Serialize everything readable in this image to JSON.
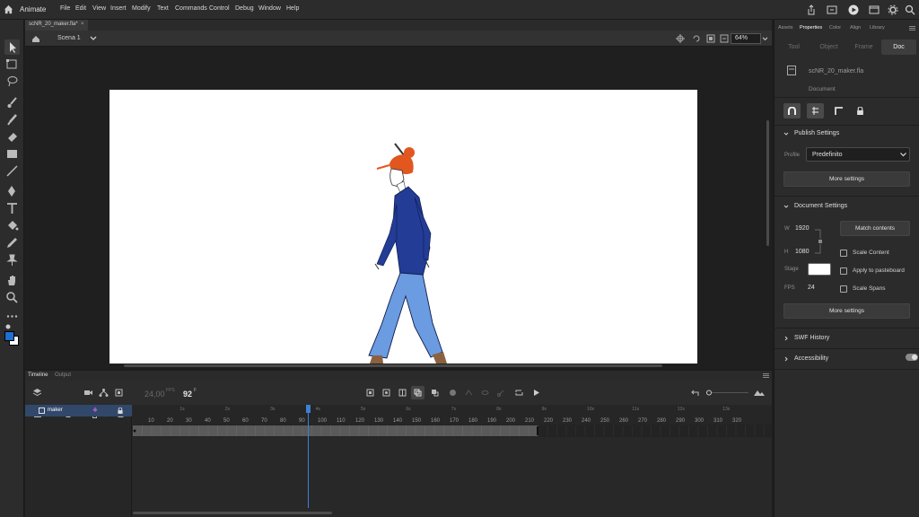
{
  "app": {
    "name": "Animate"
  },
  "menu": [
    "File",
    "Edit",
    "View",
    "Insert",
    "Modify",
    "Text",
    "Commands",
    "Control",
    "Debug",
    "Window",
    "Help"
  ],
  "document": {
    "tab_title": "scNR_20_maker.fla*",
    "tab_close": "×"
  },
  "editbar": {
    "scene": "Scena 1",
    "zoom": "64%"
  },
  "timeline": {
    "tabs": [
      "Timeline",
      "Output"
    ],
    "fps": "24,00",
    "fps_unit": "FPS",
    "current_frame": "92",
    "frame_unit": "F",
    "seconds": [
      "1s",
      "2s",
      "3s",
      "4s",
      "5s",
      "6s",
      "7s",
      "8s",
      "9s",
      "10s",
      "11s",
      "12s",
      "13s"
    ],
    "ticks": [
      "10",
      "20",
      "30",
      "40",
      "50",
      "60",
      "70",
      "80",
      "90",
      "100",
      "110",
      "120",
      "130",
      "140",
      "150",
      "160",
      "170",
      "180",
      "190",
      "200",
      "210",
      "220",
      "230",
      "240",
      "250",
      "260",
      "270",
      "280",
      "290",
      "300",
      "310",
      "320"
    ],
    "layer": {
      "name": "maker"
    }
  },
  "properties": {
    "panel_tabs": [
      "Assets",
      "Properties",
      "Color",
      "Align",
      "Library"
    ],
    "segments": [
      "Tool",
      "Object",
      "Frame",
      "Doc"
    ],
    "file_name": "scNR_20_maker.fla",
    "doc_label": "Document",
    "publish": {
      "title": "Publish Settings",
      "profile_label": "Profile",
      "profile_value": "Predefinito",
      "more": "More settings"
    },
    "doc_settings": {
      "title": "Document Settings",
      "w_label": "W",
      "w_value": "1920",
      "h_label": "H",
      "h_value": "1080",
      "match": "Match contents",
      "scale_content": "Scale Content",
      "stage_label": "Stage",
      "stage_color": "#ffffff",
      "apply_pasteboard": "Apply to pasteboard",
      "fps_label": "FPS",
      "fps_value": "24",
      "scale_spans": "Scale Spans",
      "more": "More settings"
    },
    "swf_history": "SWF History",
    "accessibility": "Accessibility"
  },
  "colors": {
    "accent": "#3f7fd6",
    "fill": "#1e6fcf",
    "stroke": "#ffffff"
  }
}
